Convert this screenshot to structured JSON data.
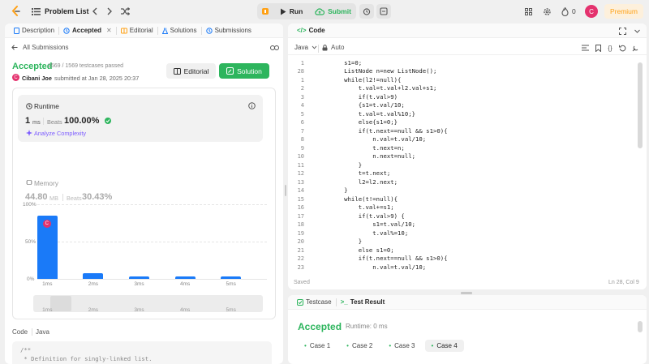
{
  "topbar": {
    "problem_list": "Problem List",
    "run": "Run",
    "submit": "Submit",
    "streak": "0",
    "avatar_letter": "C",
    "premium": "Premium"
  },
  "left_tabs": [
    {
      "label": "Description"
    },
    {
      "label": "Accepted"
    },
    {
      "label": "Editorial"
    },
    {
      "label": "Solutions"
    },
    {
      "label": "Submissions"
    }
  ],
  "submission": {
    "back": "All Submissions",
    "status": "Accepted",
    "passed": "1569 / 1569 testcases passed",
    "user": "Cibani Joe",
    "submitted": "submitted at Jan 28, 2025 20:37",
    "editorial_btn": "Editorial",
    "solution_btn": "Solution"
  },
  "runtime": {
    "title": "Runtime",
    "value": "1",
    "unit": "ms",
    "beats_label": "Beats",
    "beats": "100.00%",
    "analyze": "Analyze Complexity"
  },
  "memory": {
    "title": "Memory",
    "value": "44.80",
    "unit": "MB",
    "beats_label": "Beats",
    "beats": "30.43%"
  },
  "chart_data": {
    "type": "bar",
    "categories": [
      "1ms",
      "2ms",
      "3ms",
      "4ms",
      "5ms"
    ],
    "values": [
      85,
      8,
      3,
      3,
      3
    ],
    "y_ticks": [
      "100%",
      "50%",
      "0%"
    ],
    "ylim": [
      0,
      100
    ],
    "highlight": "1ms",
    "bar_color": "#1a7af8"
  },
  "code_section": {
    "label": "Code",
    "lang": "Java",
    "preview": [
      "/**",
      " * Definition for singly-linked list."
    ]
  },
  "editor": {
    "title": "Code",
    "lang": "Java",
    "auto": "Auto",
    "saved": "Saved",
    "cursor": "Ln 28, Col 9",
    "lines": [
      {
        "n": "",
        "code": ""
      },
      {
        "n": "1",
        "code": "        s1=0;"
      },
      {
        "n": "28",
        "code": "        ListNode n=new ListNode();"
      },
      {
        "n": "1",
        "code": "        while(l2!=null){"
      },
      {
        "n": "2",
        "code": "            t.val=t.val+l2.val+s1;"
      },
      {
        "n": "3",
        "code": "            if(t.val>9)"
      },
      {
        "n": "4",
        "code": "            {s1=t.val/10;"
      },
      {
        "n": "5",
        "code": "            t.val=t.val%10;}"
      },
      {
        "n": "6",
        "code": "            else{s1=0;}"
      },
      {
        "n": "7",
        "code": "            if(t.next==null && s1>0){"
      },
      {
        "n": "8",
        "code": "                n.val=t.val/10;"
      },
      {
        "n": "9",
        "code": "                t.next=n;"
      },
      {
        "n": "10",
        "code": "                n.next=null;"
      },
      {
        "n": "11",
        "code": "            }"
      },
      {
        "n": "12",
        "code": "            t=t.next;"
      },
      {
        "n": "13",
        "code": "            l2=l2.next;"
      },
      {
        "n": "14",
        "code": "        }"
      },
      {
        "n": "15",
        "code": "        while(t!=null){"
      },
      {
        "n": "16",
        "code": "            t.val+=s1;"
      },
      {
        "n": "17",
        "code": "            if(t.val>9) {"
      },
      {
        "n": "18",
        "code": "                s1=t.val/10;"
      },
      {
        "n": "19",
        "code": "                t.val%=10;"
      },
      {
        "n": "20",
        "code": "            }"
      },
      {
        "n": "21",
        "code": "            else s1=0;"
      },
      {
        "n": "22",
        "code": "            if(t.next==null && s1>0){"
      },
      {
        "n": "23",
        "code": "                n.val=t.val/10;"
      }
    ]
  },
  "testpanel": {
    "testcase": "Testcase",
    "result": "Test Result",
    "status": "Accepted",
    "runtime": "Runtime: 0 ms",
    "cases": [
      "Case 1",
      "Case 2",
      "Case 3",
      "Case 4"
    ]
  },
  "colors": {
    "accent_green": "#2db55d",
    "brand_orange": "#ffa116",
    "bar_blue": "#1a7af8"
  }
}
